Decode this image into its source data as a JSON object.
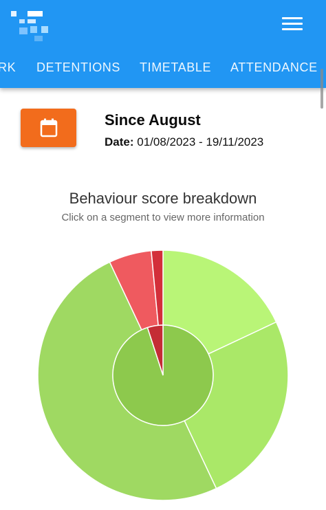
{
  "header": {
    "menu_icon": "hamburger-menu-icon",
    "tabs": [
      {
        "label": "RK"
      },
      {
        "label": "DETENTIONS"
      },
      {
        "label": "TIMETABLE"
      },
      {
        "label": "ATTENDANCE"
      }
    ],
    "brand_color": "#2196f3"
  },
  "period": {
    "title": "Since August",
    "date_label": "Date:",
    "date_range": "01/08/2023 - 19/11/2023",
    "icon": "calendar-icon",
    "button_color": "#f26c1c"
  },
  "chart": {
    "title": "Behaviour score breakdown",
    "subtitle": "Click on a segment to view more information"
  },
  "chart_data": {
    "type": "pie",
    "title": "Behaviour score breakdown",
    "inner_ring": [
      {
        "value": 95,
        "color": "#8dc94d"
      },
      {
        "value": 5,
        "color": "#c42c35"
      }
    ],
    "outer_ring": [
      {
        "value": 18,
        "color": "#b9f577"
      },
      {
        "value": 25,
        "color": "#aae868"
      },
      {
        "value": 50,
        "color": "#9fd962"
      },
      {
        "value": 5.5,
        "color": "#ef5a5f"
      },
      {
        "value": 1.5,
        "color": "#d32f3a"
      }
    ]
  }
}
